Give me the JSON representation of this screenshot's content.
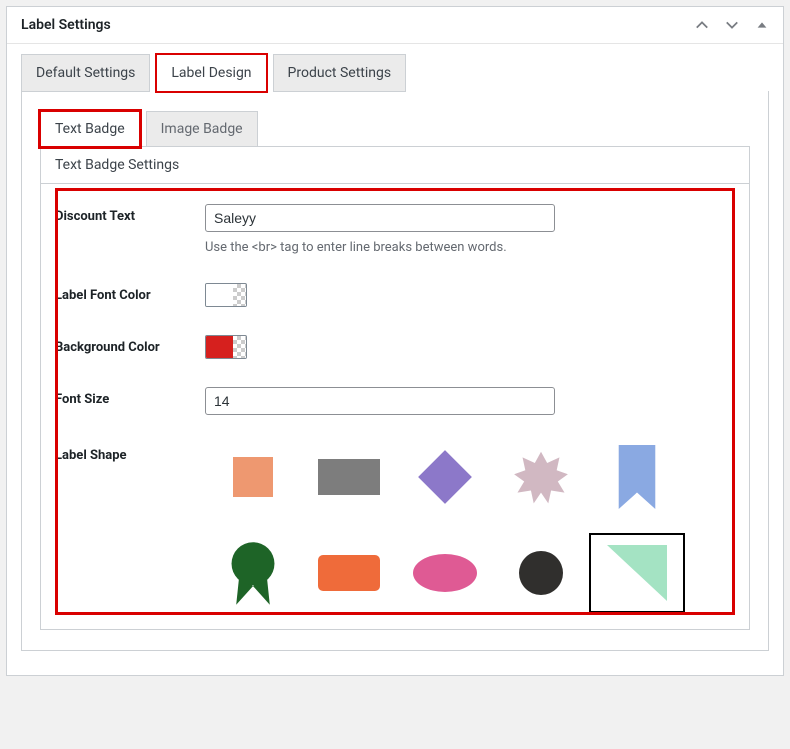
{
  "panel": {
    "title": "Label Settings"
  },
  "tabs": {
    "items": [
      {
        "label": "Default Settings"
      },
      {
        "label": "Label Design"
      },
      {
        "label": "Product Settings"
      }
    ]
  },
  "subtabs": {
    "items": [
      {
        "label": "Text Badge"
      },
      {
        "label": "Image Badge"
      }
    ]
  },
  "section": {
    "title": "Text Badge Settings"
  },
  "fields": {
    "discount_text": {
      "label": "Discount Text",
      "value": "Saleyy",
      "helper": "Use the <br> tag to enter line breaks between words."
    },
    "font_color": {
      "label": "Label Font Color",
      "value": "#ffffff"
    },
    "bg_color": {
      "label": "Background Color",
      "value": "#d6201e"
    },
    "font_size": {
      "label": "Font Size",
      "value": "14"
    },
    "shape": {
      "label": "Label Shape"
    }
  },
  "shapes": {
    "items": [
      {
        "name": "square",
        "color": "#ee9870"
      },
      {
        "name": "rectangle",
        "color": "#7d7d7d"
      },
      {
        "name": "diamond",
        "color": "#8c78c9"
      },
      {
        "name": "starburst",
        "color": "#d1b8c2"
      },
      {
        "name": "bookmark",
        "color": "#8aa9e2"
      },
      {
        "name": "ribbon-circle",
        "color": "#1e6427"
      },
      {
        "name": "rounded-rect",
        "color": "#ef6b3a"
      },
      {
        "name": "oval",
        "color": "#df5a94"
      },
      {
        "name": "circle",
        "color": "#302f2d"
      },
      {
        "name": "triangle",
        "color": "#a4e3c3",
        "selected": true
      }
    ]
  }
}
